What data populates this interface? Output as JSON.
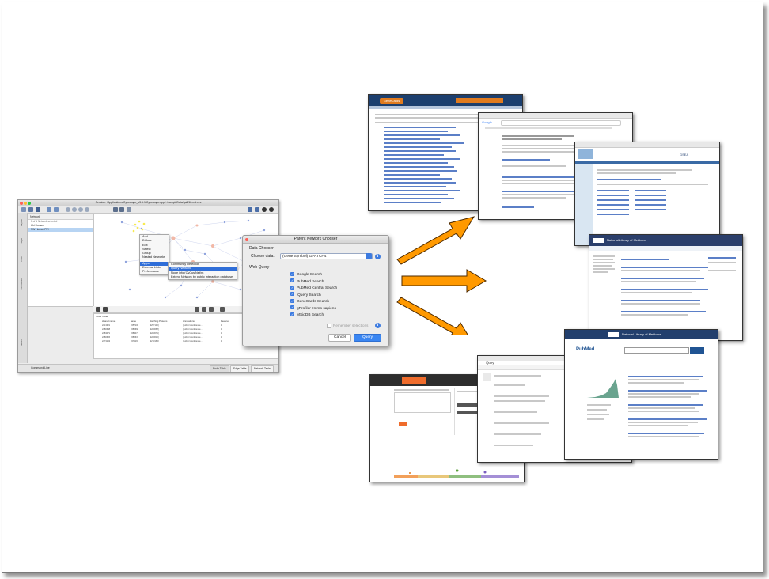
{
  "cytoscape": {
    "window_title": "Session: /Applications/Cytoscape_v3.6.1/Cytoscape.app/../sampleData/galFiltered.cys",
    "network_panel": {
      "header": "Network",
      "count": "1 of 1 Network selected",
      "rows": [
        "Ubi Human",
        "NW Human PPI"
      ]
    },
    "side_tabs": [
      "Layout",
      "Style",
      "Filter",
      "Annotation",
      "Select"
    ],
    "context_menu": [
      "Add",
      "Diffuse",
      "Edit",
      "Select",
      "Group",
      "Nested Networks",
      "Apps",
      "External Links",
      "Preferences"
    ],
    "apps_menu_highlight": "Apps",
    "submenu": [
      "Community Detection",
      "Query Network",
      "Node info (CyCustNet/n)",
      "Extend Network by public interaction database"
    ],
    "submenu_highlight": "Query Network",
    "table_header": "Node Table",
    "table_columns": [
      "shared name",
      "name",
      "Matching Proteins",
      "Annotations",
      "Features",
      "Format"
    ],
    "table_rows": [
      [
        "2213321",
        "2257106",
        "[2257106]",
        "[author=conference...",
        "1",
        "ENST5??"
      ],
      [
        "2280668",
        "2280668",
        "[2280668]",
        "[author=conference...",
        "1",
        "ENS073"
      ],
      [
        "2283071",
        "2283071",
        "[2283071]",
        "[author=conference...",
        "1",
        "ENS3??"
      ],
      [
        "2280615",
        "2280615",
        "[2280615]",
        "[author=conference...",
        "1",
        "ENST??"
      ],
      [
        "2273163",
        "2273163",
        "[2273163]",
        "[author=conference...",
        "1",
        "ENST0"
      ]
    ],
    "bottom_tabs": [
      "Node Table",
      "Edge Table",
      "Network Table"
    ],
    "command_line": "Command Line"
  },
  "dialog": {
    "title": "Parent Network Chooser",
    "section_data": "Data Chooser",
    "choose_label": "Choose data:",
    "choose_value": "(Gene Symbol) GPATCH4",
    "section_web": "Web Query",
    "checkboxes": [
      {
        "label": "Google Search",
        "checked": true
      },
      {
        "label": "PubMed Search",
        "checked": true
      },
      {
        "label": "PubMed Central Search",
        "checked": true
      },
      {
        "label": "iQuery Search",
        "checked": true
      },
      {
        "label": "GeneCards Search",
        "checked": true
      },
      {
        "label": "gProfiler Homo sapiens",
        "checked": true
      },
      {
        "label": "MSigDB Search",
        "checked": true
      }
    ],
    "remember": "Remember selections",
    "cancel": "Cancel",
    "query": "Query"
  },
  "colors": {
    "arrow_fill": "#ff9900",
    "arrow_stroke": "#4d2a00",
    "accent_blue": "#3d7be0",
    "genecards_orange": "#e07b1f",
    "nlm_navy": "#1f3d6e"
  },
  "shots": {
    "genecards": {
      "brand": "GeneCards"
    },
    "google": {
      "brand": "Google"
    },
    "msigdb": {
      "brand": "GSEA"
    },
    "pmc": {
      "brand": "National Library of Medicine"
    },
    "pubmed": {
      "brand": "National Library of Medicine",
      "logo": "PubMed"
    },
    "gprofiler": {
      "brand": "g:Profiler"
    },
    "iquery": {
      "brand": "iQuery"
    }
  }
}
